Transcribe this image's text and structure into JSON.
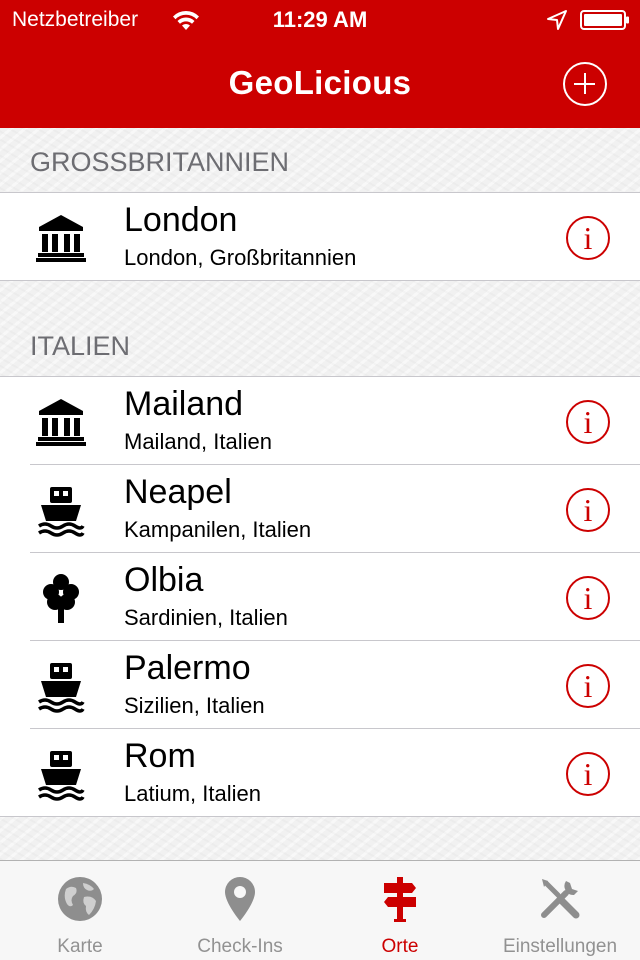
{
  "status_bar": {
    "carrier": "Netzbetreiber",
    "time": "11:29 AM"
  },
  "nav": {
    "title": "GeoLicious",
    "add_icon": "plus-circle-icon"
  },
  "colors": {
    "accent": "#cc0000",
    "inactive": "#929292"
  },
  "sections": [
    {
      "header": "GROSSBRITANNIEN",
      "rows": [
        {
          "title": "London",
          "subtitle": "London, Großbritannien",
          "icon": "museum-icon"
        }
      ]
    },
    {
      "header": "ITALIEN",
      "rows": [
        {
          "title": "Mailand",
          "subtitle": "Mailand, Italien",
          "icon": "museum-icon"
        },
        {
          "title": "Neapel",
          "subtitle": "Kampanilen, Italien",
          "icon": "ship-icon"
        },
        {
          "title": "Olbia",
          "subtitle": "Sardinien, Italien",
          "icon": "tree-icon"
        },
        {
          "title": "Palermo",
          "subtitle": "Sizilien, Italien",
          "icon": "ship-icon"
        },
        {
          "title": "Rom",
          "subtitle": "Latium, Italien",
          "icon": "ship-icon"
        }
      ]
    }
  ],
  "info_glyph": "i",
  "tabs": [
    {
      "label": "Karte",
      "icon": "globe-icon",
      "active": false
    },
    {
      "label": "Check-Ins",
      "icon": "map-pin-icon",
      "active": false
    },
    {
      "label": "Orte",
      "icon": "signpost-icon",
      "active": true
    },
    {
      "label": "Einstellungen",
      "icon": "tools-icon",
      "active": false
    }
  ]
}
